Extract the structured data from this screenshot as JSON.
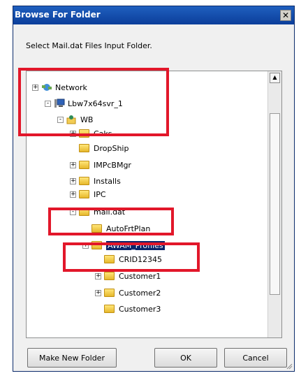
{
  "window": {
    "title": "Browse For Folder"
  },
  "instruction": "Select Mail.dat Files Input Folder.",
  "tree": {
    "items": [
      {
        "label": "Network",
        "expander": "+",
        "icon": "network-icon"
      },
      {
        "label": "Lbw7x64svr_1",
        "expander": "-",
        "icon": "computer-icon"
      },
      {
        "label": "WB",
        "expander": "-",
        "icon": "user-folder-icon"
      },
      {
        "label": "Caks",
        "expander": "+",
        "icon": "folder-icon"
      },
      {
        "label": "DropShip",
        "expander": "",
        "icon": "folder-icon"
      },
      {
        "label": "IMPcBMgr",
        "expander": "+",
        "icon": "folder-icon"
      },
      {
        "label": "Installs",
        "expander": "+",
        "icon": "folder-icon"
      },
      {
        "label": "IPC",
        "expander": "+",
        "icon": "folder-icon"
      },
      {
        "label": "mail.dat",
        "expander": "-",
        "icon": "folder-icon"
      },
      {
        "label": "AutoFrtPlan",
        "expander": "",
        "icon": "folder-icon"
      },
      {
        "label": "AWAM_Profiles",
        "expander": "+",
        "icon": "folder-icon",
        "selected": true
      },
      {
        "label": "CRID12345",
        "expander": "",
        "icon": "folder-icon"
      },
      {
        "label": "Customer1",
        "expander": "+",
        "icon": "folder-icon"
      },
      {
        "label": "Customer2",
        "expander": "+",
        "icon": "folder-icon"
      },
      {
        "label": "Customer3",
        "expander": "",
        "icon": "folder-icon"
      }
    ]
  },
  "buttons": {
    "make_new_folder": "Make New Folder",
    "ok": "OK",
    "cancel": "Cancel"
  },
  "colors": {
    "highlight": "#e2172a",
    "selection": "#0a246a",
    "title_bar": "#0b3e9a"
  }
}
